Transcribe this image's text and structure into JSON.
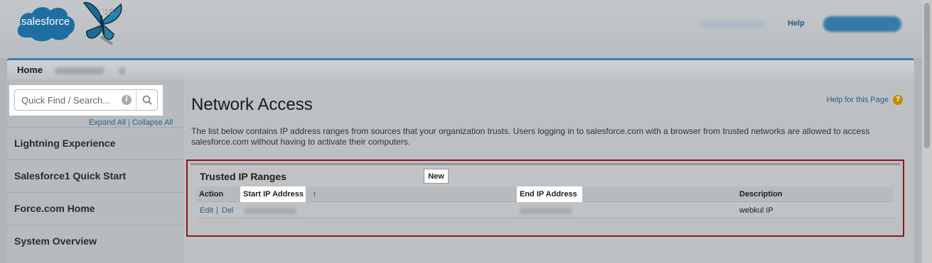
{
  "header": {
    "logo_text": "salesforce",
    "release_badge": "'16",
    "help_label": "Help",
    "colors": {
      "brand_blue": "#1f6ea3",
      "accent": "#3b7eb2"
    }
  },
  "tabs": {
    "home_label": "Home"
  },
  "sidebar": {
    "search_placeholder": "Quick Find / Search...",
    "expand_all": "Expand All",
    "separator": "|",
    "collapse_all": "Collapse All",
    "items": [
      {
        "label": "Lightning Experience"
      },
      {
        "label": "Salesforce1 Quick Start"
      },
      {
        "label": "Force.com Home"
      },
      {
        "label": "System Overview"
      }
    ]
  },
  "main": {
    "title": "Network Access",
    "help_page_label": "Help for this Page",
    "help_icon_glyph": "?",
    "description": "The list below contains IP address ranges from sources that your organization trusts. Users logging in to salesforce.com with a browser from trusted networks are allowed to access salesforce.com without having to activate their computers.",
    "panel": {
      "title": "Trusted IP Ranges",
      "new_button": "New",
      "columns": {
        "action": "Action",
        "start": "Start IP Address",
        "sort_indicator": "↑",
        "end": "End IP Address",
        "description": "Description"
      },
      "rows": [
        {
          "edit": "Edit",
          "sep": "|",
          "del": "Del",
          "description": "webkul IP"
        }
      ]
    }
  }
}
